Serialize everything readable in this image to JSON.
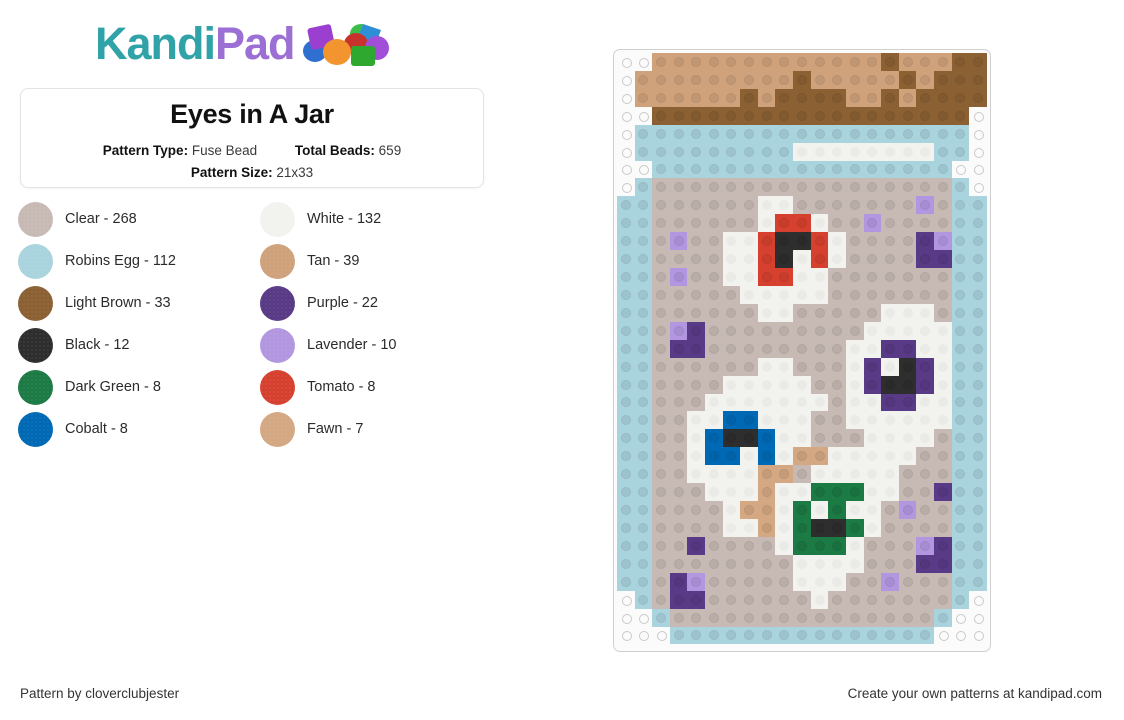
{
  "brand": {
    "name_part1": "Kandi",
    "name_part2": "Pad",
    "color_teal": "#2fa3a8",
    "color_purple": "#9b6fd4"
  },
  "pattern": {
    "title": "Eyes in A Jar",
    "type_label": "Pattern Type:",
    "type_value": "Fuse Bead",
    "total_label": "Total Beads:",
    "total_value": "659",
    "size_label": "Pattern Size:",
    "size_value": "21x33",
    "columns": 21,
    "rows": 33
  },
  "legend": [
    {
      "name": "Clear - 268",
      "color": "#c7bab4",
      "key": "C"
    },
    {
      "name": "White - 132",
      "color": "#f2f2ef",
      "key": "W"
    },
    {
      "name": "Robins Egg - 112",
      "color": "#a9d3dd",
      "key": "R"
    },
    {
      "name": "Tan - 39",
      "color": "#cfa27c",
      "key": "T"
    },
    {
      "name": "Light Brown - 33",
      "color": "#8b6134",
      "key": "L"
    },
    {
      "name": "Purple - 22",
      "color": "#593a86",
      "key": "P"
    },
    {
      "name": "Black - 12",
      "color": "#2e2e2e",
      "key": "K"
    },
    {
      "name": "Lavender - 10",
      "color": "#b297e0",
      "key": "V"
    },
    {
      "name": "Dark Green - 8",
      "color": "#1c7a44",
      "key": "G"
    },
    {
      "name": "Tomato - 8",
      "color": "#d6412f",
      "key": "O"
    },
    {
      "name": "Cobalt - 8",
      "color": "#0069b5",
      "key": "B"
    },
    {
      "name": "Fawn - 7",
      "color": "#d3a882",
      "key": "F"
    }
  ],
  "palette": {
    "C": "#c7bab4",
    "W": "#f2f2ef",
    "R": "#a9d3dd",
    "T": "#cfa27c",
    "L": "#8b6134",
    "P": "#593a86",
    "K": "#2e2e2e",
    "V": "#b297e0",
    "G": "#1c7a44",
    "O": "#d6412f",
    "B": "#0069b5",
    "F": "#d3a882",
    ".": null
  },
  "grid": [
    "..TTTTTTTTTTTTTLTTTLL",
    ".TTTTTTTTTLTTTTTLTLLL",
    ".TTTTTTLTLLLLTTLTLLLL",
    "..LLLLLLLLLLLLLLLLLL.",
    ".RRRRRRRRRRRRRRRRRRR.",
    ".RRRRRRRRRWWWWWWWWRR.",
    "..RRRRRRRRRRRRRRRRR..",
    ".RCCCCCCCCCCCCCCCCCR.",
    "RRCCCCCCWWCCCCCCCVCRR",
    "RRCCCCCCWOOWCCVCCCCRR",
    "RRCVCCWWOKKOWCCCCPVRR",
    "RRCCCCWWOKWOWCCCCPPRR",
    "RRCVCCWWOOWWCCCCCCCRR",
    "RRCCCCCWWWWWCCCCCCCRR",
    "RRCCCCCCWWCCCCCWWWCRR",
    "RRCVPCCCCCCCCCWWWWWRR",
    "RRCPPCCCCCCCCWWPPWWRR",
    "RRCCCCCCWWCCCWPWKPWRR",
    "RRCCCCWWWWWCCWPKKPWRR",
    "RRCCCWWWWWWWCWWPPWWRR",
    "RRCCWWBBWWWCCWWWWWWRR",
    "RRCCWBKKBWWCCCWWWWCRR",
    "RRCCWBBWBWFFWWWWWCCRR",
    "RRCCWWWWFFCWWWWWCCCRR",
    "RRCCCWWWFWWGGGWWCCPRR",
    "RRCCCCWFFWGWGWWCVCCRR",
    "RRCCCCWWFWGKKGWCCCCRR",
    "RRCCPCCCCWGGGWCCCVPRR",
    "RRCCCCCCCCWWWWCCCPPRR",
    "RRCPVCCCCCWWWCCVCCCRR",
    ".RCPPCCCCCCWCCCCCCCR.",
    "..RCCCCCCCCCCCCCCCR..",
    "...RRRRRRRRRRRRRRR..."
  ],
  "footer": {
    "left": "Pattern by cloverclubjester",
    "right": "Create your own patterns at kandipad.com"
  }
}
